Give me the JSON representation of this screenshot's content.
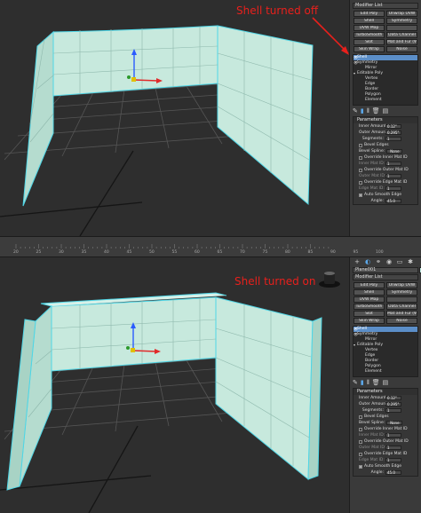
{
  "panels": [
    {
      "annotation": "Shell turned off",
      "object_name": "",
      "modifier_list": "Modifier List",
      "buttons": [
        "Edit Poly",
        "Unwrap UVW",
        "Shell",
        "Symmetry",
        "UVW Map",
        "",
        "TurboSmooth",
        "Data Channel",
        "Slot",
        "Mat and Fur (WSM)",
        "Skin Wrap",
        "Noise"
      ],
      "stack": [
        {
          "label": "Shell",
          "selected": true,
          "sub": false
        },
        {
          "label": "Symmetry",
          "selected": false,
          "sub": false
        },
        {
          "label": "Mirror",
          "selected": false,
          "sub": true
        },
        {
          "label": "Editable Poly",
          "selected": false,
          "sub": false
        },
        {
          "label": "Vertex",
          "selected": false,
          "sub": true
        },
        {
          "label": "Edge",
          "selected": false,
          "sub": true
        },
        {
          "label": "Border",
          "selected": false,
          "sub": true
        },
        {
          "label": "Polygon",
          "selected": false,
          "sub": true
        },
        {
          "label": "Element",
          "selected": false,
          "sub": true
        }
      ],
      "rollout_title": "Parameters",
      "params": {
        "inner_amount_label": "Inner Amount:",
        "inner_amount": "0.12\"",
        "outer_amount_label": "Outer Amount:",
        "outer_amount": "0.295\"",
        "segments_label": "Segments:",
        "segments": "1",
        "bevel_edges": "Bevel Edges",
        "bevel_spline_label": "Bevel Spline:",
        "bevel_spline": "None",
        "override_inner": "Override Inner Mat ID",
        "inner_mat_label": "Inner Mat ID:",
        "inner_mat": "1",
        "override_outer": "Override Outer Mat ID",
        "outer_mat_label": "Outer Mat ID:",
        "outer_mat": "1",
        "override_edge": "Override Edge Mat ID",
        "edge_mat_label": "Edge Mat ID:",
        "edge_mat": "1",
        "auto_smooth": "Auto Smooth Edge",
        "angle_label": "Angle:",
        "angle": "45.0"
      }
    },
    {
      "annotation": "Shell turned on",
      "object_name": "Plane001",
      "modifier_list": "Modifier List",
      "buttons": [
        "Edit Poly",
        "Unwrap UVW",
        "Shell",
        "Symmetry",
        "UVW Map",
        "",
        "TurboSmooth",
        "Data Channel",
        "Slot",
        "Mat and Fur (WSM)",
        "Skin Wrap",
        "Noise"
      ],
      "stack": [
        {
          "label": "Shell",
          "selected": true,
          "sub": false
        },
        {
          "label": "Symmetry",
          "selected": false,
          "sub": false
        },
        {
          "label": "Mirror",
          "selected": false,
          "sub": true
        },
        {
          "label": "Editable Poly",
          "selected": false,
          "sub": false
        },
        {
          "label": "Vertex",
          "selected": false,
          "sub": true
        },
        {
          "label": "Edge",
          "selected": false,
          "sub": true
        },
        {
          "label": "Border",
          "selected": false,
          "sub": true
        },
        {
          "label": "Polygon",
          "selected": false,
          "sub": true
        },
        {
          "label": "Element",
          "selected": false,
          "sub": true
        }
      ],
      "rollout_title": "Parameters",
      "params": {
        "inner_amount_label": "Inner Amount:",
        "inner_amount": "0.12\"",
        "outer_amount_label": "Outer Amount:",
        "outer_amount": "0.295\"",
        "segments_label": "Segments:",
        "segments": "1",
        "bevel_edges": "Bevel Edges",
        "bevel_spline_label": "Bevel Spline:",
        "bevel_spline": "None",
        "override_inner": "Override Inner Mat ID",
        "inner_mat_label": "Inner Mat ID:",
        "inner_mat": "1",
        "override_outer": "Override Outer Mat ID",
        "outer_mat_label": "Outer Mat ID:",
        "outer_mat": "1",
        "override_edge": "Override Edge Mat ID",
        "edge_mat_label": "Edge Mat ID:",
        "edge_mat": "1",
        "auto_smooth": "Auto Smooth Edge",
        "angle_label": "Angle:",
        "angle": "45.0"
      }
    }
  ],
  "timeline": {
    "ticks": [
      "20",
      "25",
      "30",
      "35",
      "40",
      "45",
      "50",
      "55",
      "60",
      "65",
      "70",
      "75",
      "80",
      "85",
      "90",
      "95",
      "100"
    ]
  },
  "colors": {
    "mesh_fill": "#c7e9dd",
    "mesh_edge": "#4fd6e6",
    "selected_row": "#5b8ec8",
    "annotation": "#e8201c"
  }
}
